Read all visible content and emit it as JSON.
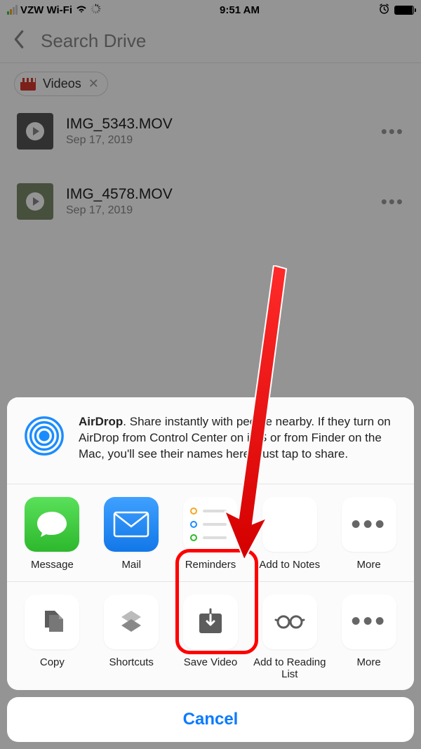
{
  "statusbar": {
    "carrier": "VZW Wi-Fi",
    "time": "9:51 AM"
  },
  "navbar": {
    "title": "Search Drive"
  },
  "chip": {
    "label": "Videos"
  },
  "files": [
    {
      "name": "IMG_5343.MOV",
      "date": "Sep 17, 2019"
    },
    {
      "name": "IMG_4578.MOV",
      "date": "Sep 17, 2019"
    }
  ],
  "airdrop": {
    "bold": "AirDrop",
    "text": ". Share instantly with people nearby. If they turn on AirDrop from Control Center on iOS or from Finder on the Mac, you'll see their names here. Just tap to share."
  },
  "share_row": [
    {
      "label": "Message"
    },
    {
      "label": "Mail"
    },
    {
      "label": "Reminders"
    },
    {
      "label": "Add to Notes"
    },
    {
      "label": "More"
    }
  ],
  "action_row": [
    {
      "label": "Copy"
    },
    {
      "label": "Shortcuts"
    },
    {
      "label": "Save Video"
    },
    {
      "label": "Add to Reading List"
    },
    {
      "label": "More"
    }
  ],
  "cancel": "Cancel"
}
